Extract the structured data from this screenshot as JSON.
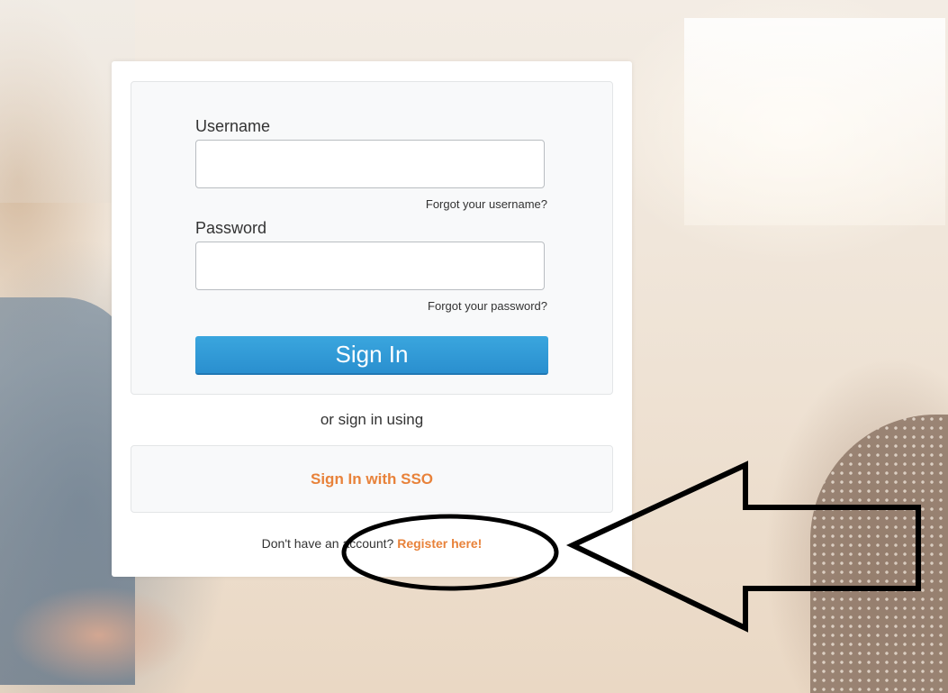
{
  "login_form": {
    "username_label": "Username",
    "username_value": "",
    "forgot_username": "Forgot your username?",
    "password_label": "Password",
    "password_value": "",
    "forgot_password": "Forgot your password?",
    "signin_label": "Sign In"
  },
  "alt_signin": {
    "or_text": "or sign in using",
    "sso_label": "Sign In with SSO"
  },
  "register": {
    "prompt": "Don't have an account?",
    "link_label": "Register here!"
  },
  "colors": {
    "primary_button": "#2a98d6",
    "link_orange": "#e8823a",
    "annotation": "#000000"
  },
  "annotation": {
    "shapes": [
      "ellipse",
      "arrow"
    ]
  }
}
